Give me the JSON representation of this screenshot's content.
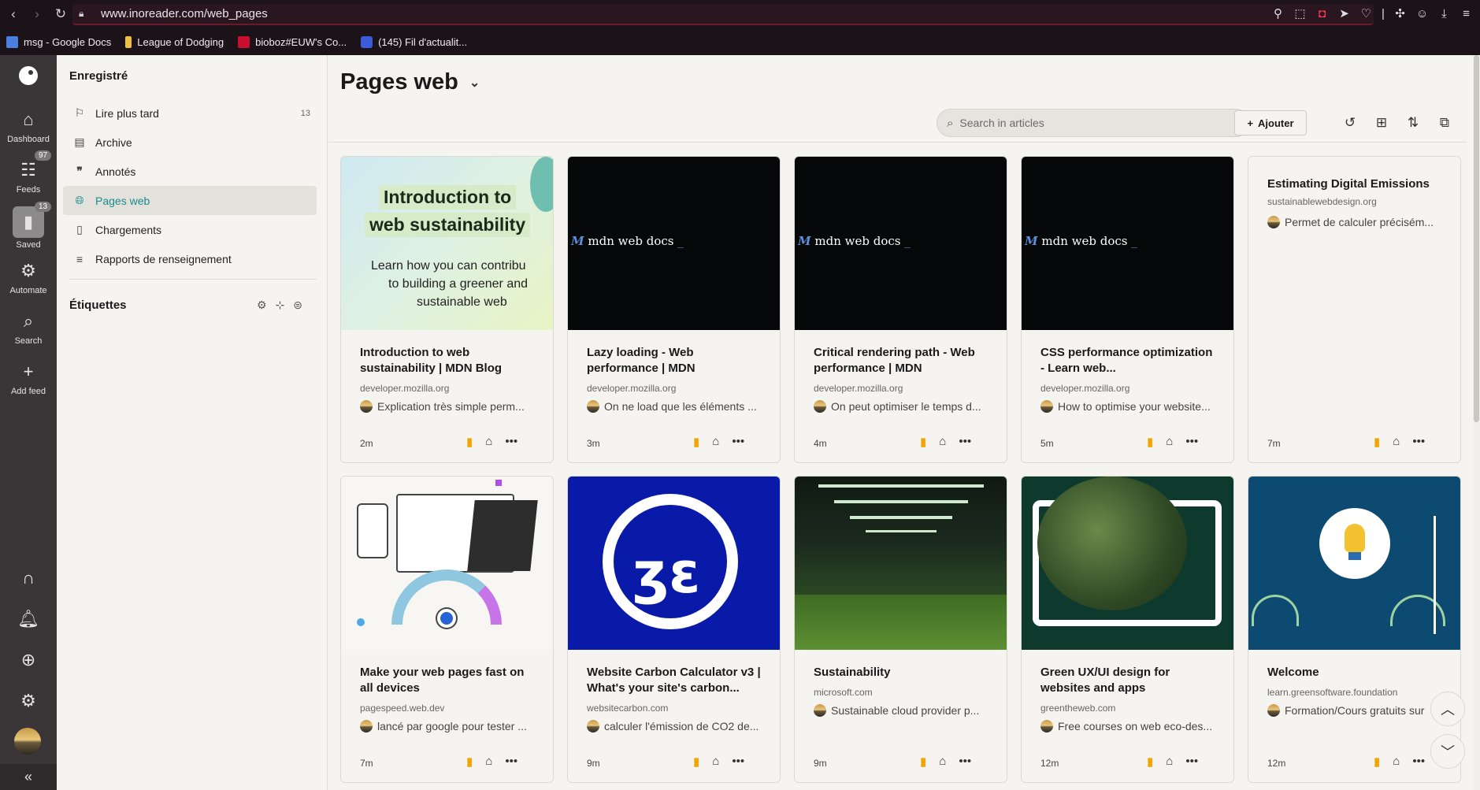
{
  "browser": {
    "url": "www.inoreader.com/web_pages",
    "bookmarks": [
      {
        "label": "msg - Google Docs",
        "color": "#4a7fe0"
      },
      {
        "label": "League of Dodging",
        "color": "#f0c040"
      },
      {
        "label": "bioboz#EUW's Co...",
        "color": "#c8102e"
      },
      {
        "label": "(145) Fil d'actualit...",
        "color": "#3b5bdb"
      }
    ]
  },
  "rail": {
    "items": [
      {
        "label": "Dashboard",
        "icon": "home-icon"
      },
      {
        "label": "Feeds",
        "icon": "feeds-icon",
        "badge": "97"
      },
      {
        "label": "Saved",
        "icon": "bookmark-icon",
        "badge": "13"
      },
      {
        "label": "Automate",
        "icon": "automate-icon"
      },
      {
        "label": "Search",
        "icon": "search-icon"
      },
      {
        "label": "Add feed",
        "icon": "plus-icon"
      }
    ]
  },
  "panel": {
    "title": "Enregistré",
    "nav": [
      {
        "label": "Lire plus tard",
        "icon": "bookmark-icon",
        "count": "13"
      },
      {
        "label": "Archive",
        "icon": "archive-icon",
        "count": ""
      },
      {
        "label": "Annotés",
        "icon": "quote-icon",
        "count": ""
      },
      {
        "label": "Pages web",
        "icon": "globe-icon",
        "count": ""
      },
      {
        "label": "Chargements",
        "icon": "document-icon",
        "count": ""
      },
      {
        "label": "Rapports de renseignement",
        "icon": "report-icon",
        "count": ""
      }
    ],
    "tags_title": "Étiquettes"
  },
  "main": {
    "title": "Pages web",
    "search_placeholder": "Search in articles",
    "add_label": "Ajouter",
    "cards": [
      {
        "title": "Introduction to web sustainability | MDN Blog",
        "domain": "developer.mozilla.org",
        "note": "Explication très simple perm...",
        "time": "2m",
        "image": "sustainability"
      },
      {
        "title": "Lazy loading - Web performance | MDN",
        "domain": "developer.mozilla.org",
        "note": "On ne load que les éléments ...",
        "time": "3m",
        "image": "mdn",
        "image_text": "mdn web docs"
      },
      {
        "title": "Critical rendering path - Web performance | MDN",
        "domain": "developer.mozilla.org",
        "note": "On peut optimiser le temps d...",
        "time": "4m",
        "image": "mdn",
        "image_text": "mdn web docs"
      },
      {
        "title": "CSS performance optimization - Learn web...",
        "domain": "developer.mozilla.org",
        "note": "How to optimise your website...",
        "time": "5m",
        "image": "mdn",
        "image_text": "mdn web docs"
      },
      {
        "title": "Estimating Digital Emissions",
        "domain": "sustainablewebdesign.org",
        "note": "Permet de calculer précisém...",
        "time": "7m",
        "image": "none"
      },
      {
        "title": "Make your web pages fast on all devices",
        "domain": "pagespeed.web.dev",
        "note": "lancé par google pour tester ...",
        "time": "7m",
        "image": "pagespeed"
      },
      {
        "title": "Website Carbon Calculator v3 | What's your site's carbon...",
        "domain": "websitecarbon.com",
        "note": "calculer l'émission de CO2 de...",
        "time": "9m",
        "image": "carbon"
      },
      {
        "title": "Sustainability",
        "domain": "microsoft.com",
        "note": "Sustainable cloud provider p...",
        "time": "9m",
        "image": "datacenter"
      },
      {
        "title": "Green UX/UI design for websites and apps",
        "domain": "greentheweb.com",
        "note": "Free courses on web eco-des...",
        "time": "12m",
        "image": "plant"
      },
      {
        "title": "Welcome",
        "domain": "learn.greensoftware.foundation",
        "note": "Formation/Cours gratuits sur",
        "time": "12m",
        "image": "welcome"
      }
    ]
  },
  "sustainability_image": {
    "line1": "Introduction to",
    "line2": "web sustainability",
    "sub1": "Learn how you can contribu",
    "sub2": "to building a greener and",
    "sub3": "sustainable web"
  },
  "colors": {
    "accent": "#1a8c8c",
    "bookmark": "#f0a500"
  }
}
